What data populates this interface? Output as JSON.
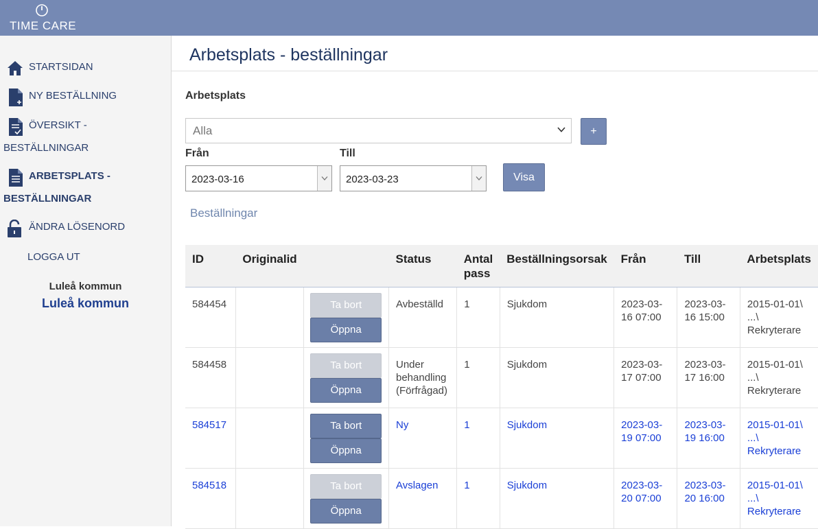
{
  "app": {
    "logo_text": "TIME CARE"
  },
  "sidebar": {
    "items": [
      {
        "line1": "STARTSIDAN",
        "line2": ""
      },
      {
        "line1": "NY BESTÄLLNING",
        "line2": ""
      },
      {
        "line1": "ÖVERSIKT -",
        "line2": "BESTÄLLNINGAR"
      },
      {
        "line1": "ARBETSPLATS -",
        "line2": "BESTÄLLNINGAR"
      },
      {
        "line1": "ÄNDRA LÖSENORD",
        "line2": ""
      },
      {
        "line1": "LOGGA UT",
        "line2": ""
      }
    ],
    "org_small": "Luleå kommun",
    "org_big": "Luleå kommun"
  },
  "page": {
    "title": "Arbetsplats - beställningar"
  },
  "filters": {
    "workplace_label": "Arbetsplats",
    "workplace_value": "Alla",
    "add_label": "+",
    "from_label": "Från",
    "from_value": "2023-03-16",
    "to_label": "Till",
    "to_value": "2023-03-23",
    "show_label": "Visa"
  },
  "orders": {
    "section_title": "Beställningar",
    "headers": {
      "id": "ID",
      "original": "Originalid",
      "actions": "",
      "status": "Status",
      "count_1": "Antal",
      "count_2": "pass",
      "reason": "Beställningsorsak",
      "from": "Från",
      "to": "Till",
      "workplace": "Arbetsplats"
    },
    "delete_label": "Ta bort",
    "open_label": "Öppna",
    "rows": [
      {
        "id": "584454",
        "original": "",
        "status": "Avbeställd",
        "count": "1",
        "reason": "Sjukdom",
        "from": "2023-03-16 07:00",
        "to": "2023-03-16 15:00",
        "workplace": "2015-01-01\\ ...\\ Rekryterare"
      },
      {
        "id": "584458",
        "original": "",
        "status": "Under behandling (Förfrågad)",
        "count": "1",
        "reason": "Sjukdom",
        "from": "2023-03-17 07:00",
        "to": "2023-03-17 16:00",
        "workplace": "2015-01-01\\ ...\\ Rekryterare"
      },
      {
        "id": "584517",
        "original": "",
        "status": "Ny",
        "count": "1",
        "reason": "Sjukdom",
        "from": "2023-03-19 07:00",
        "to": "2023-03-19 16:00",
        "workplace": "2015-01-01\\ ...\\ Rekryterare"
      },
      {
        "id": "584518",
        "original": "",
        "status": "Avslagen",
        "count": "1",
        "reason": "Sjukdom",
        "from": "2023-03-20 07:00",
        "to": "2023-03-20 16:00",
        "workplace": "2015-01-01\\ ...\\ Rekryterare"
      }
    ]
  },
  "colors": {
    "topbar": "#7589b4",
    "nav_text": "#2a3f6c",
    "link_blue": "#1a3fd6",
    "button": "#6b7fa8",
    "button_disabled": "#ccd0d8"
  }
}
